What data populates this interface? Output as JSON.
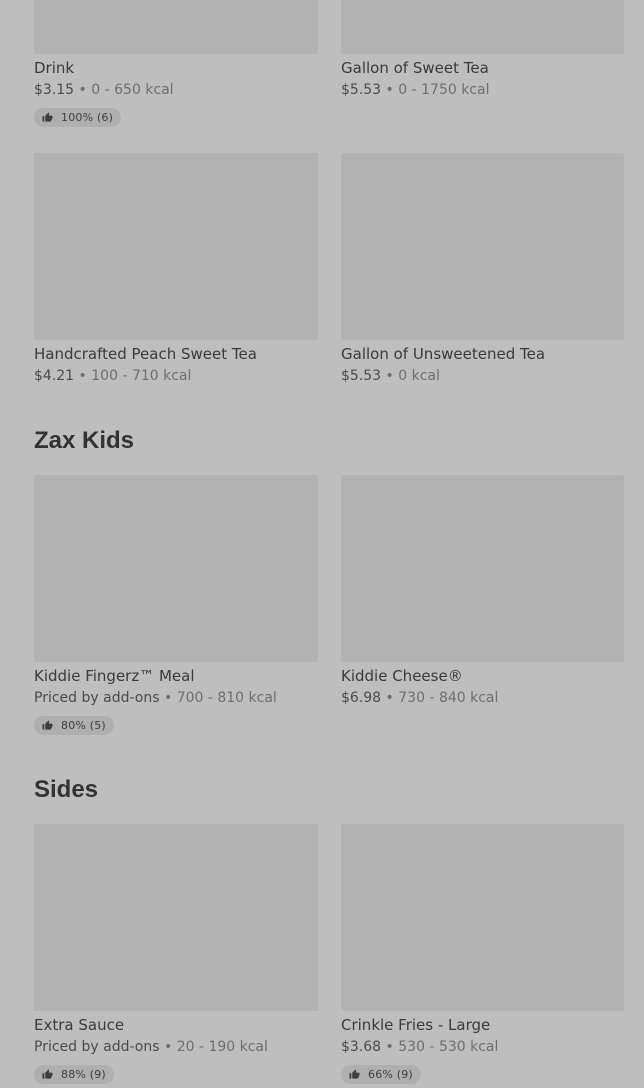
{
  "sections": {
    "drinks": {
      "items": [
        {
          "name": "Drink",
          "price": "$3.15",
          "sep": "•",
          "kcal": "0 - 650 kcal",
          "rating": "100% (6)"
        },
        {
          "name": "Gallon of Sweet Tea",
          "price": "$5.53",
          "sep": "•",
          "kcal": "0 - 1750 kcal"
        },
        {
          "name": "Handcrafted Peach Sweet Tea",
          "price": "$4.21",
          "sep": "•",
          "kcal": "100 - 710 kcal"
        },
        {
          "name": "Gallon of Unsweetened Tea",
          "price": "$5.53",
          "sep": "•",
          "kcal": "0 kcal"
        }
      ]
    },
    "kids": {
      "title": "Zax Kids",
      "items": [
        {
          "name": "Kiddie Fingerz™ Meal",
          "price": "Priced by add-ons",
          "sep": "•",
          "kcal": "700 - 810 kcal",
          "rating": "80% (5)"
        },
        {
          "name": "Kiddie Cheese®",
          "price": "$6.98",
          "sep": "•",
          "kcal": "730 - 840 kcal"
        }
      ]
    },
    "sides": {
      "title": "Sides",
      "items": [
        {
          "name": "Extra Sauce",
          "price": "Priced by add-ons",
          "sep": "•",
          "kcal": "20 - 190 kcal",
          "rating": "88% (9)"
        },
        {
          "name": "Crinkle Fries - Large",
          "price": "$3.68",
          "sep": "•",
          "kcal": "530 - 530 kcal",
          "rating": "66% (9)"
        }
      ]
    }
  },
  "icons": {
    "rating": "thumbs-up-icon"
  },
  "colors": {
    "background": "#bebebe",
    "image_placeholder": "#b2b2b2",
    "rating_pill": "#afafaf"
  }
}
